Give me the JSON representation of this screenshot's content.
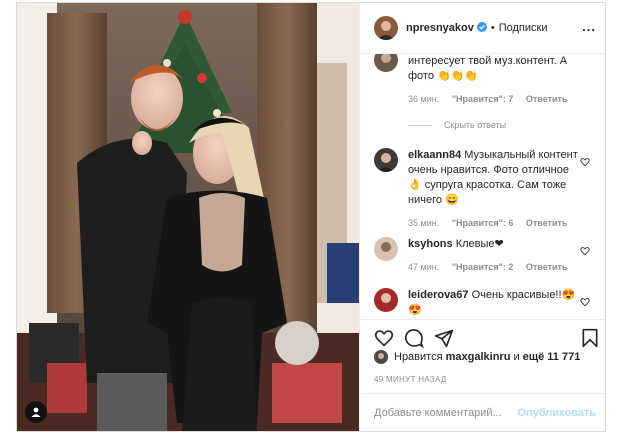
{
  "header": {
    "username": "npresnyakov",
    "separator": "•",
    "follow_label": "Подписки",
    "more": "..."
  },
  "comments": [
    {
      "text": "интересует твой муз.контент. А фото 👏👏👏",
      "time": "36 мин.",
      "likes": "\"Нравится\": 7",
      "reply": "Ответить"
    },
    {
      "username": "elkaann84",
      "text": "Музыкальный контент очень нравится. Фото отличное👌 супруга красотка. Сам тоже ничего 😄",
      "time": "35 мин.",
      "likes": "\"Нравится\": 6",
      "reply": "Ответить"
    },
    {
      "username": "ksyhons",
      "text": "Клевые❤",
      "time": "47 мин.",
      "likes": "\"Нравится\": 2",
      "reply": "Ответить"
    },
    {
      "username": "leiderova67",
      "text": "Очень красивые!!😍😍"
    }
  ],
  "hide_replies": "Скрыть ответы",
  "likes_line": {
    "prefix": "Нравится",
    "user": "maxgalkinru",
    "middle": "и",
    "rest": "ещё 11 771"
  },
  "timestamp": "49 МИНУТ НАЗАД",
  "add_comment": {
    "placeholder": "Добавьте комментарий...",
    "post_label": "Опубликовать"
  },
  "colors": {
    "accent": "#0095f6",
    "post_disabled": "#b2dffc",
    "muted": "#8e8e8e",
    "text": "#262626"
  }
}
